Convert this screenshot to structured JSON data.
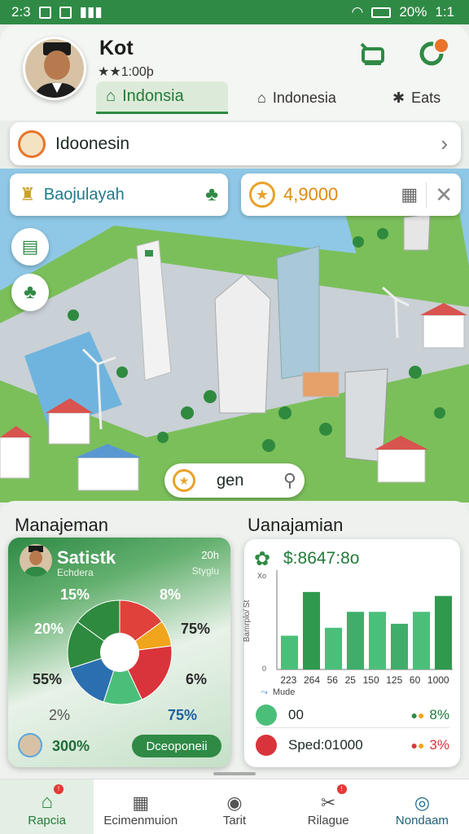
{
  "status": {
    "time": "2:3",
    "battery": "20%",
    "extra": "1:1"
  },
  "header": {
    "username": "Kot",
    "rating": "★★1:00þ",
    "tabs": [
      {
        "label": "Indonsia",
        "active": true
      },
      {
        "label": "Indonesia",
        "active": false
      },
      {
        "label": "Eats",
        "active": false
      }
    ]
  },
  "location": {
    "label": "Idoonesin"
  },
  "city": {
    "place_chip": "Baojulayah",
    "money_chip": "4,9000",
    "search_label": "gen"
  },
  "panels": {
    "left_title": "Manajeman",
    "right_title": "Uanajamian"
  },
  "stats_card": {
    "title": "Satistk",
    "subtitle": "Echdera",
    "top_right": "20h",
    "top_right_sub": "Styglu",
    "labels": [
      "15%",
      "8%",
      "20%",
      "75%",
      "55%",
      "6%",
      "2%",
      "75%"
    ],
    "footer_value": "300%",
    "button_label": "Dceoponeii",
    "chart_data": {
      "type": "pie",
      "values": [
        15,
        8,
        20,
        12,
        15,
        15,
        15
      ],
      "colors": [
        "#e0413a",
        "#f0a51c",
        "#d9343b",
        "#4bbf7a",
        "#2c6fb0",
        "#2e8a3e",
        "#2e8a3e"
      ]
    }
  },
  "revenue_card": {
    "amount": "$:8647:8o",
    "y_axis_label": "Bamrplo/ St",
    "yticks": [
      "Xo",
      "0"
    ],
    "legend_label": "Mude",
    "rows": [
      {
        "label": "00",
        "value": "8%",
        "color": "#4bbf7a"
      },
      {
        "label": "Sped:01000",
        "value": "3%",
        "color": "#d9343b"
      }
    ],
    "chart_data": {
      "type": "bar",
      "categories": [
        "223",
        "264",
        "56",
        "25",
        "150",
        "125",
        "60",
        "1000"
      ],
      "values": [
        34,
        78,
        42,
        58,
        58,
        46,
        58,
        74
      ],
      "ylim": [
        0,
        100
      ]
    }
  },
  "nav": [
    {
      "label": "Rapcia",
      "active": true,
      "badge": true
    },
    {
      "label": "Ecimenmuion",
      "active": false,
      "badge": false
    },
    {
      "label": "Tarit",
      "active": false,
      "badge": false
    },
    {
      "label": "Rilague",
      "active": false,
      "badge": true
    },
    {
      "label": "Nondaam",
      "active": false,
      "badge": false
    }
  ]
}
